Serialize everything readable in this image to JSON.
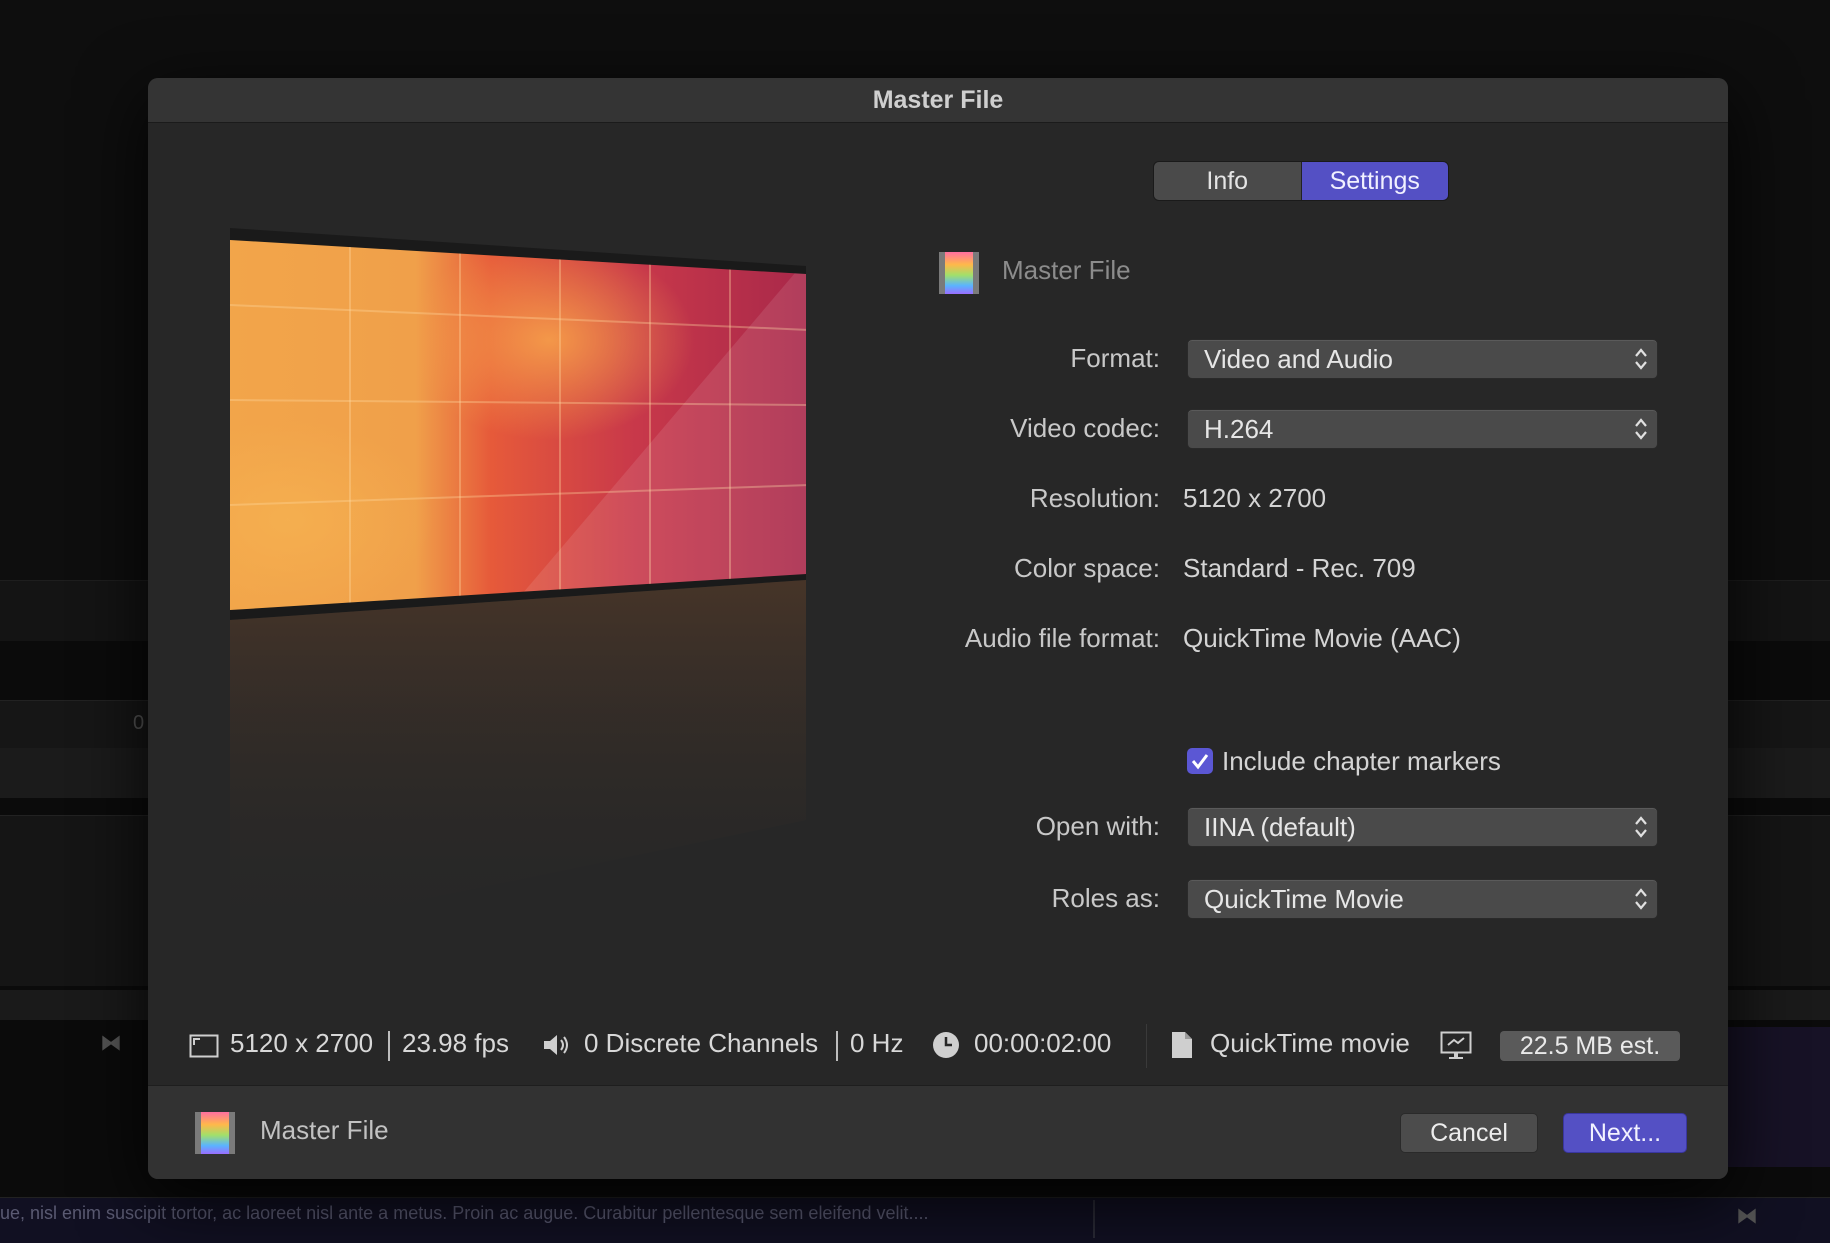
{
  "background": {
    "ticker_text": "ue, nisl enim suscipit tortor, ac laoreet nisl ante a metus. Proin ac augue. Curabitur pellentesque sem eleifend velit....",
    "timeline_marker": "0"
  },
  "dialog": {
    "title": "Master File",
    "tabs": [
      {
        "label": "Info",
        "active": false
      },
      {
        "label": "Settings",
        "active": true
      }
    ],
    "header": {
      "icon": "film-strip-icon",
      "title": "Master File"
    },
    "fields": {
      "format": {
        "label": "Format:",
        "value": "Video and Audio"
      },
      "video_codec": {
        "label": "Video codec:",
        "value": "H.264"
      },
      "resolution": {
        "label": "Resolution:",
        "value": "5120 x 2700"
      },
      "color_space": {
        "label": "Color space:",
        "value": "Standard - Rec. 709"
      },
      "audio_file_format": {
        "label": "Audio file format:",
        "value": "QuickTime Movie (AAC)"
      },
      "chapter_markers": {
        "label": "Include chapter markers",
        "checked": true
      },
      "open_with": {
        "label": "Open with:",
        "value": "IINA (default)"
      },
      "roles_as": {
        "label": "Roles as:",
        "value": "QuickTime Movie"
      }
    },
    "status": {
      "resolution": "5120 x 2700",
      "fps": "23.98 fps",
      "channels": "0 Discrete Channels",
      "rate": "0 Hz",
      "duration": "00:00:02:00",
      "file_type": "QuickTime movie",
      "estimate": "22.5 MB est."
    },
    "footer": {
      "title": "Master File",
      "cancel_label": "Cancel",
      "next_label": "Next..."
    },
    "colors": {
      "accent": "#5450c4",
      "dialog_bg": "#272727",
      "preview_gradient": [
        "#f2a54a",
        "#e65a3a",
        "#b8304a",
        "#a22a4a"
      ]
    }
  }
}
